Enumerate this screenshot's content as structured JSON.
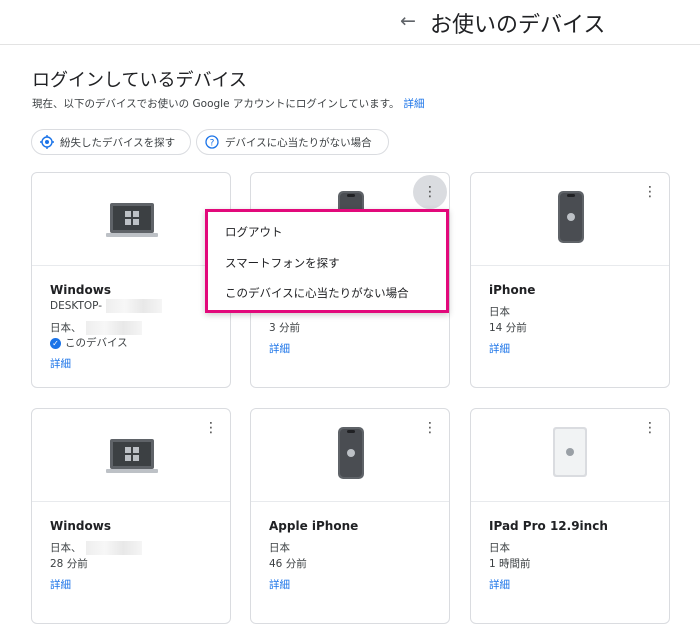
{
  "header": {
    "back_icon": "arrow-left-icon",
    "title": "お使いのデバイス"
  },
  "section": {
    "title": "ログインしているデバイス",
    "description": "現在、以下のデバイスでお使いの Google アカウントにログインしています。",
    "details_link": "詳細"
  },
  "chips": [
    {
      "label": "紛失したデバイスを探す",
      "icon": "locate-icon"
    },
    {
      "label": "デバイスに心当たりがない場合",
      "icon": "help-icon"
    }
  ],
  "cards": [
    {
      "name": "Windows",
      "line1": "DESKTOP-",
      "line2": "日本、",
      "this_device": "このデバイス",
      "details": "詳細"
    },
    {
      "line3": "3 分前",
      "details": "詳細"
    },
    {
      "name": "iPhone",
      "line1": "日本",
      "line2": "14 分前",
      "details": "詳細"
    },
    {
      "name": "Windows",
      "line1": "日本、",
      "line2": "28 分前",
      "details": "詳細"
    },
    {
      "name": "Apple iPhone",
      "line1": "日本",
      "line2": "46 分前",
      "details": "詳細"
    },
    {
      "name": "IPad Pro 12.9inch",
      "line1": "日本",
      "line2": "1 時間前",
      "details": "詳細"
    }
  ],
  "menu": {
    "items": [
      "ログアウト",
      "スマートフォンを探す",
      "このデバイスに心当たりがない場合"
    ],
    "highlight_color": "#e2097b"
  },
  "colors": {
    "link": "#1a73e8",
    "check": "#1a73e8"
  }
}
